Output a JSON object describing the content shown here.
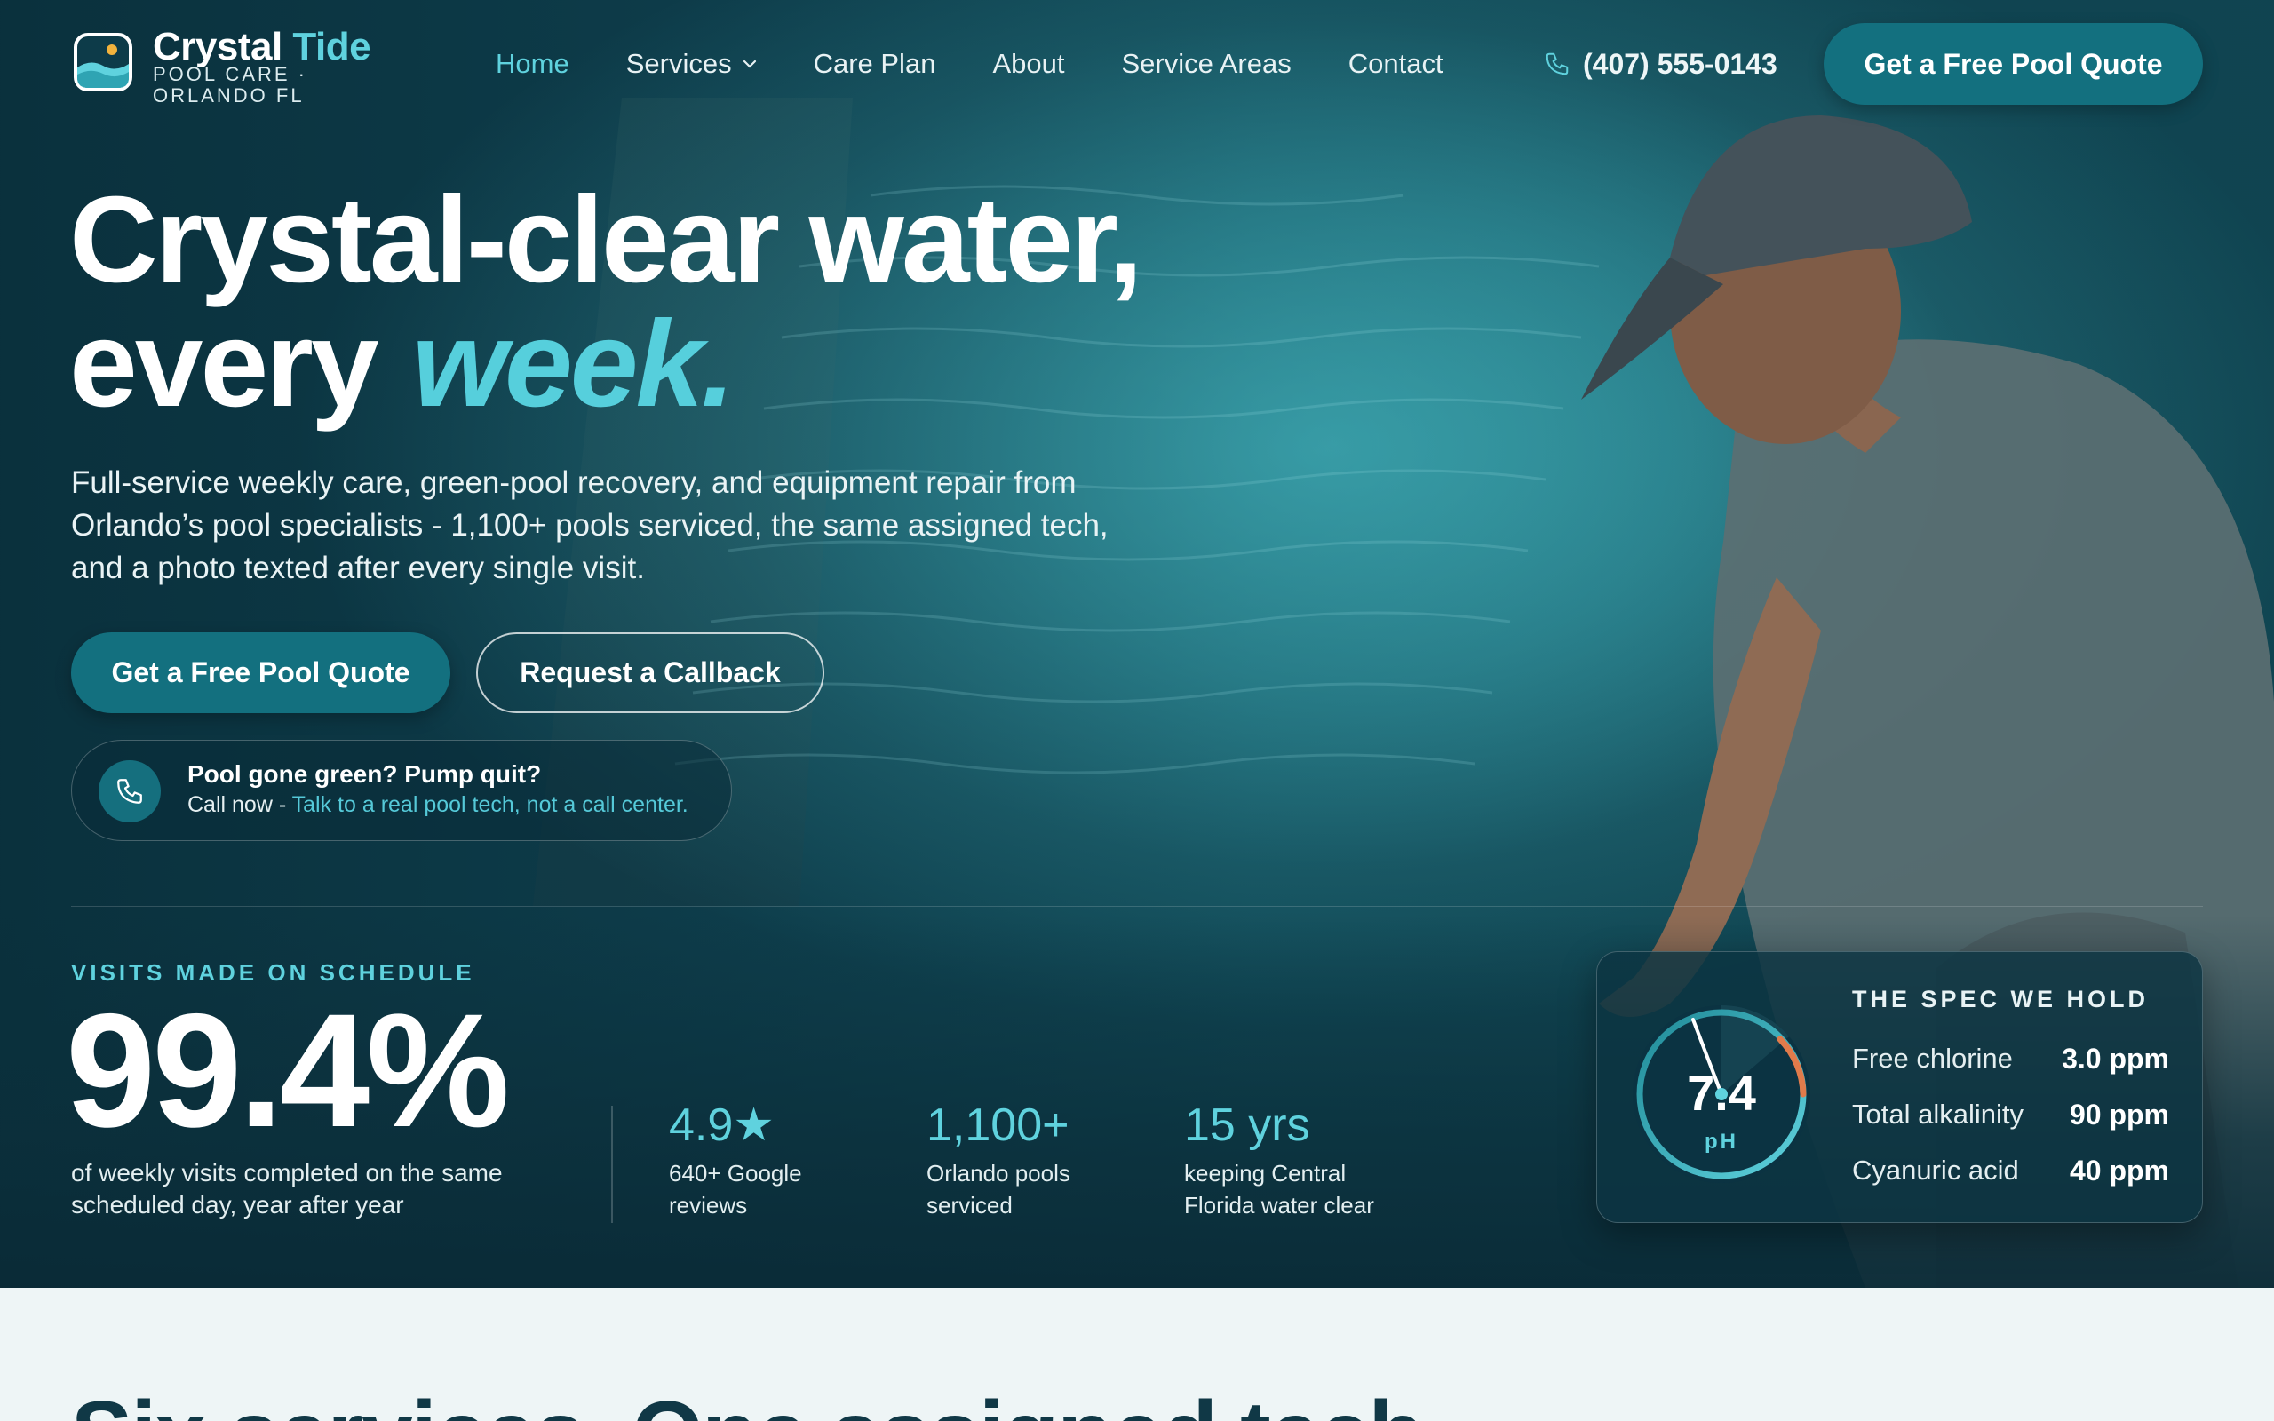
{
  "brand": {
    "name_part1": "Crystal",
    "name_part2": "Tide",
    "tagline": "POOL CARE · ORLANDO FL"
  },
  "nav": {
    "items": [
      {
        "label": "Home",
        "active": true
      },
      {
        "label": "Services",
        "dropdown": true
      },
      {
        "label": "Care Plan"
      },
      {
        "label": "About"
      },
      {
        "label": "Service Areas"
      },
      {
        "label": "Contact"
      }
    ],
    "phone": "(407) 555-0143",
    "cta": "Get a Free Pool Quote"
  },
  "hero": {
    "headline_line1": "Crystal-clear water,",
    "headline_line2_plain": "every",
    "headline_line2_accent": "week.",
    "subcopy": "Full-service weekly care, green-pool recovery, and equipment repair from Orlando’s pool specialists - 1,100+ pools serviced, the same assigned tech, and a photo texted after every single visit.",
    "primary_button": "Get a Free Pool Quote",
    "secondary_button": "Request a Callback",
    "callout_title": "Pool gone green? Pump quit?",
    "callout_lead": "Call now - ",
    "callout_link": "Talk to a real pool tech, not a call center."
  },
  "stats": {
    "headline_label": "VISITS MADE ON SCHEDULE",
    "headline_value": "99.4%",
    "headline_desc": "of weekly visits completed on the same scheduled day, year after year",
    "items": [
      {
        "value": "4.9★",
        "label": "640+ Google reviews"
      },
      {
        "value": "1,100+",
        "label": "Orlando pools serviced"
      },
      {
        "value": "15 yrs",
        "label": "keeping Central Florida water clear"
      }
    ]
  },
  "spec": {
    "title": "THE SPEC WE HOLD",
    "gauge_value": "7.4",
    "gauge_unit": "pH",
    "rows": [
      {
        "name": "Free chlorine",
        "value": "3.0 ppm"
      },
      {
        "name": "Total alkalinity",
        "value": "90 ppm"
      },
      {
        "name": "Cyanuric acid",
        "value": "40 ppm"
      }
    ]
  },
  "next_section": {
    "heading": "Six services. One assigned tech."
  },
  "colors": {
    "accent": "#5fd2de",
    "button": "#13707f",
    "hero_dark": "#0b3140",
    "section_bg": "#eef5f6"
  },
  "icons": {
    "logo": "wave-sun-logo-icon",
    "phone": "phone-icon",
    "chevron": "chevron-down-icon"
  }
}
